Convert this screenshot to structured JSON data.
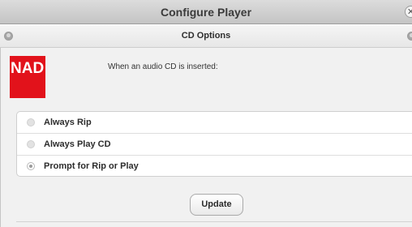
{
  "window": {
    "title": "Configure Player",
    "close_icon": "close-icon"
  },
  "subheader": {
    "title": "CD Options",
    "left_icon": "back-nav-icon",
    "right_icon": "forward-nav-icon"
  },
  "logo": {
    "text": "NAD",
    "color": "#e2121b"
  },
  "prompt": "When an audio CD is inserted:",
  "options": [
    {
      "label": "Always Rip",
      "selected": false
    },
    {
      "label": "Always Play CD",
      "selected": false
    },
    {
      "label": "Prompt for Rip or Play",
      "selected": true
    }
  ],
  "update_label": "Update"
}
